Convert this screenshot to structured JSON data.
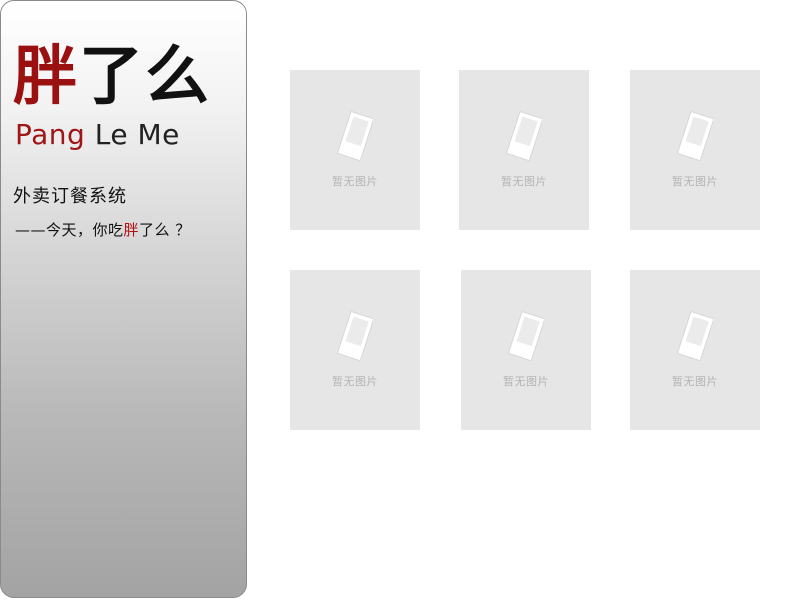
{
  "logo": {
    "cn_char1": "胖",
    "cn_char2": "了",
    "cn_char3": "么",
    "en_word1": "Pang",
    "en_word2": "Le",
    "en_word3": "Me"
  },
  "app_subtitle": "外卖订餐系统",
  "slogan": {
    "prefix": "——今天，你吃",
    "highlight": "胖",
    "suffix": "了么 ？"
  },
  "colors": {
    "brand_red": "#9b1010",
    "tile_bg": "#e6e6e6",
    "placeholder_text": "#b4b4b4"
  },
  "tiles": [
    {
      "placeholder_icon": "image-placeholder-icon",
      "label": "暂无图片"
    },
    {
      "placeholder_icon": "image-placeholder-icon",
      "label": "暂无图片"
    },
    {
      "placeholder_icon": "image-placeholder-icon",
      "label": "暂无图片"
    },
    {
      "placeholder_icon": "image-placeholder-icon",
      "label": "暂无图片"
    },
    {
      "placeholder_icon": "image-placeholder-icon",
      "label": "暂无图片"
    },
    {
      "placeholder_icon": "image-placeholder-icon",
      "label": "暂无图片"
    }
  ]
}
